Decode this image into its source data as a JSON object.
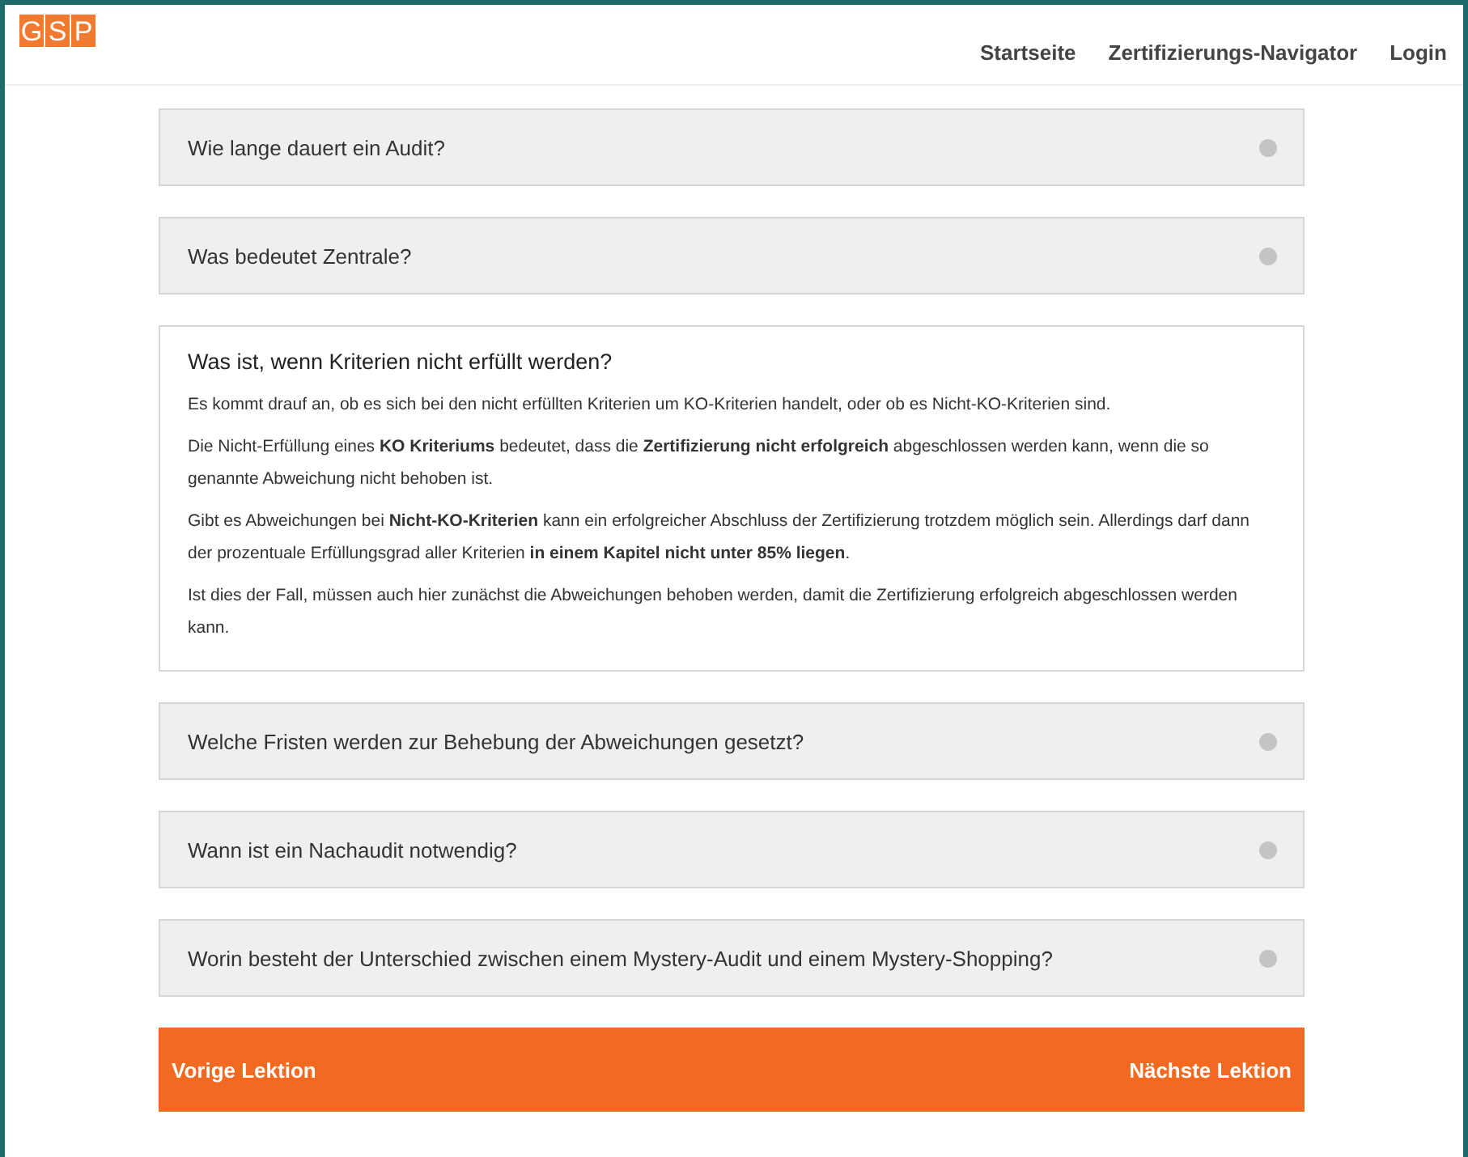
{
  "logo": {
    "letters": [
      "G",
      "S",
      "P"
    ]
  },
  "nav": [
    {
      "label": "Startseite"
    },
    {
      "label": "Zertifizierungs-Navigator"
    },
    {
      "label": "Login"
    }
  ],
  "faq": [
    {
      "question": "Wie lange dauert ein Audit?",
      "expanded": false
    },
    {
      "question": "Was bedeutet Zentrale?",
      "expanded": false
    },
    {
      "question": "Was ist, wenn Kriterien nicht erfüllt werden?",
      "expanded": true,
      "answer": [
        "Es kommt drauf an, ob es sich bei den nicht erfüllten Kriterien um KO-Kriterien handelt, oder ob es Nicht-KO-Kriterien sind.",
        "Die Nicht-Erfüllung eines **KO Kriteriums** bedeutet, dass die **Zertifizierung nicht erfolgreich** abgeschlossen werden kann, wenn die so genannte Abweichung nicht behoben ist.",
        "Gibt es Abweichungen bei **Nicht-KO-Kriterien** kann ein erfolgreicher Abschluss der Zertifizierung trotzdem möglich sein. Allerdings darf dann der prozentuale Erfüllungsgrad aller Kriterien **in einem Kapitel nicht unter 85% liegen**.",
        "Ist dies der Fall, müssen auch hier zunächst die Abweichungen behoben werden, damit die Zertifizierung erfolgreich abgeschlossen werden kann."
      ]
    },
    {
      "question": "Welche Fristen werden zur Behebung der Abweichungen gesetzt?",
      "expanded": false
    },
    {
      "question": "Wann ist ein Nachaudit notwendig?",
      "expanded": false
    },
    {
      "question": "Worin besteht der Unterschied zwischen einem Mystery-Audit und einem Mystery-Shopping?",
      "expanded": false
    }
  ],
  "lesson_nav": {
    "previous": "Vorige Lektion",
    "next": "Nächste Lektion"
  }
}
